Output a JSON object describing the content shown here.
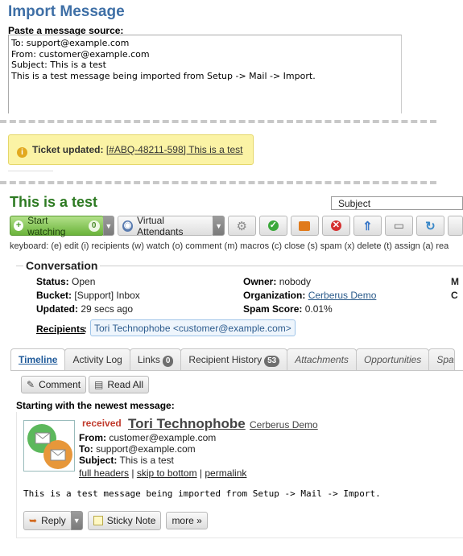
{
  "import": {
    "title": "Import Message",
    "source_label": "Paste a message source:",
    "source_lines": [
      "To: support@example.com",
      "From: customer@example.com",
      "Subject: This is a test",
      "",
      "This is a test message being imported from Setup -> Mail -> Import."
    ]
  },
  "notice": {
    "label": "Ticket updated:",
    "link": "[#ABQ-48211-598] This is a test"
  },
  "ticket": {
    "title": "This is a test",
    "select_value": "Subject"
  },
  "toolbar": {
    "watch_label": "Start watching",
    "watch_count": "0",
    "attendants_label": "Virtual Attendants"
  },
  "keyboard_hint": "keyboard: (e) edit (i) recipients (w) watch (o) comment (m) macros (c) close (s) spam (x) delete (t) assign (a) rea",
  "conversation": {
    "legend": "Conversation",
    "status_label": "Status:",
    "status_value": "Open",
    "bucket_label": "Bucket:",
    "bucket_value": "[Support] Inbox",
    "updated_label": "Updated:",
    "updated_value": "29 secs ago",
    "owner_label": "Owner:",
    "owner_value": "nobody",
    "org_label": "Organization:",
    "org_value": "Cerberus Demo",
    "spam_label": "Spam Score:",
    "spam_value": "0.01%",
    "right_edge_1": "M",
    "right_edge_2": "C"
  },
  "recipients": {
    "label": "Recipients",
    "colon": ":",
    "chip": "Tori Technophobe <customer@example.com>"
  },
  "tabs": [
    {
      "label": "Timeline"
    },
    {
      "label": "Activity Log"
    },
    {
      "label": "Links",
      "count": "0"
    },
    {
      "label": "Recipient History",
      "count": "53"
    },
    {
      "label": "Attachments"
    },
    {
      "label": "Opportunities"
    },
    {
      "label": "Spa"
    }
  ],
  "timeline_actions": {
    "comment": "Comment",
    "read_all": "Read All"
  },
  "starting_text": "Starting with the newest message:",
  "message": {
    "status": "received",
    "sender": "Tori Technophobe",
    "org": "Cerberus Demo",
    "from_label": "From:",
    "from_value": "customer@example.com",
    "to_label": "To:",
    "to_value": "support@example.com",
    "subject_label": "Subject:",
    "subject_value": "This is a test",
    "link_full_headers": "full headers",
    "link_skip_bottom": "skip to bottom",
    "link_permalink": "permalink",
    "sep": "|",
    "body": "This is a test message being imported from Setup -> Mail -> Import."
  },
  "message_actions": {
    "reply": "Reply",
    "sticky_note": "Sticky Note",
    "more": "more »"
  },
  "colors": {
    "heading_blue": "#3e6fa6",
    "title_green": "#2d7a22",
    "received_red": "#c0392b",
    "notice_yellow": "#fbf3a5"
  }
}
